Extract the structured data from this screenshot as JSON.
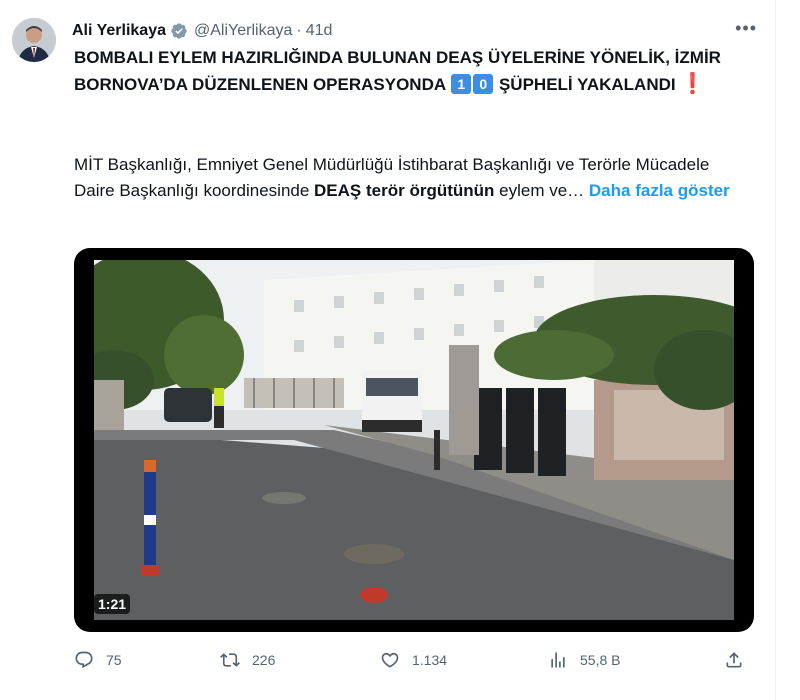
{
  "author": {
    "name": "Ali Yerlikaya",
    "handle": "@AliYerlikaya",
    "separator": "·",
    "time": "41d"
  },
  "more_label": "•••",
  "headline": {
    "part1": "BOMBALI EYLEM HAZIRLIĞINDA BULUNAN DEAŞ ÜYELERİNE YÖNELİK, İZMİR BORNOVA’DA DÜZENLENEN OPERASYONDA ",
    "keycap1": "1",
    "keycap2": "0",
    "part2": " ŞÜPHELİ YAKALANDI",
    "excl": "❗"
  },
  "body": {
    "part1": "MİT Başkanlığı, Emniyet Genel Müdürlüğü İstihbarat Başkanlığı ve Terörle Mücadele Daire Başkanlığı koordinesinde ",
    "bold": "DEAŞ terör örgütünün",
    "part2": " eylem ve… ",
    "show_more": "Daha fazla göster"
  },
  "media": {
    "duration": "1:21"
  },
  "actions": {
    "replies": "75",
    "retweets": "226",
    "likes": "1.134",
    "views": "55,8 B"
  },
  "colors": {
    "accent": "#1d9bf0",
    "muted": "#536471",
    "keycap": "#3c8ee5"
  }
}
